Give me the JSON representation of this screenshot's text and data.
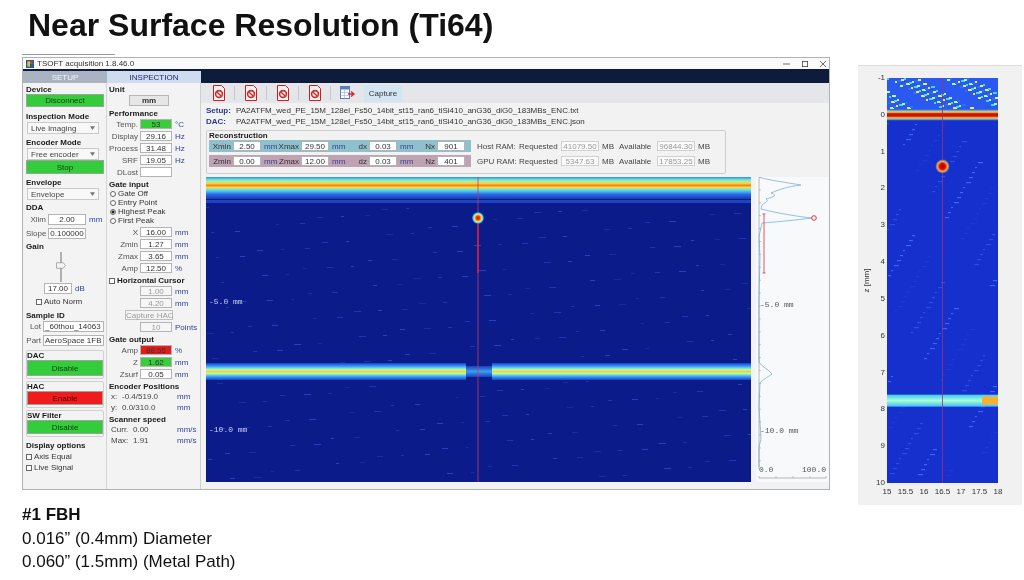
{
  "slide": {
    "title": "Near Surface Resolution (Ti64)"
  },
  "app": {
    "window_title": "TSOFT acquisition 1.8.46.0",
    "tabs": [
      {
        "label": "SETUP",
        "selected": false
      },
      {
        "label": "INSPECTION",
        "selected": true
      }
    ],
    "left_panel": {
      "device": {
        "heading": "Device",
        "button": {
          "label": "Disconnect",
          "color": "#33cc3a"
        }
      },
      "inspection_mode": {
        "heading": "Inspection Mode",
        "value": "Live Imaging"
      },
      "encoder_mode": {
        "heading": "Encoder Mode",
        "value": "Free encoder"
      },
      "stop_button": {
        "label": "Stop",
        "color": "#33cc3a"
      },
      "envelope": {
        "heading": "Envelope",
        "value": "Envelope"
      },
      "dda": {
        "heading": "DDA",
        "fields": [
          {
            "label": "Xlim",
            "value": "2.00",
            "unit": "mm"
          },
          {
            "label": "Slope",
            "value": "0.100000"
          }
        ]
      },
      "gain": {
        "heading": "Gain",
        "level": 0.55,
        "value": "17.00",
        "unit": "dB"
      },
      "auto_norm": {
        "label": "Auto Norm",
        "checked": false
      },
      "sample_id": {
        "heading": "Sample ID",
        "fields": [
          {
            "label": "Lot",
            "value": "_60thou_14063"
          },
          {
            "label": "Part",
            "value": "AeroSpace 1FB"
          }
        ]
      },
      "switches": [
        {
          "heading": "DAC",
          "button": "Disable",
          "color": "#33cc3a"
        },
        {
          "heading": "HAC",
          "button": "Enable",
          "color": "#ee1c1c"
        },
        {
          "heading": "SW Filter",
          "button": "Disable",
          "color": "#33cc3a"
        }
      ],
      "display_options": {
        "heading": "Display options",
        "checkboxes": [
          {
            "label": "Axis Equal",
            "checked": false
          },
          {
            "label": "Live Signal",
            "checked": false
          }
        ]
      }
    },
    "middle_panel": {
      "unit": {
        "heading": "Unit",
        "button": "mm"
      },
      "performance": {
        "heading": "Performance",
        "fields": [
          {
            "label": "Temp.",
            "value": "53",
            "unit": "°C",
            "color": "#3acc3a"
          },
          {
            "label": "Display",
            "value": "29.16",
            "unit": "Hz"
          },
          {
            "label": "Process",
            "value": "31.48",
            "unit": "Hz"
          },
          {
            "label": "SRF",
            "value": "19.05",
            "unit": "Hz"
          },
          {
            "label": "DLost"
          }
        ]
      },
      "gate_input": {
        "heading": "Gate input",
        "options": [
          {
            "label": "Gate Off",
            "selected": false
          },
          {
            "label": "Entry Point",
            "selected": false
          },
          {
            "label": "Highest Peak",
            "selected": true
          },
          {
            "label": "First Peak",
            "selected": false
          }
        ],
        "fields": [
          {
            "label": "X",
            "value": "16.00",
            "unit": "mm"
          },
          {
            "label": "Zmin",
            "value": "1.27",
            "unit": "mm"
          },
          {
            "label": "Zmax",
            "value": "3.65",
            "unit": "mm"
          },
          {
            "label": "Amp",
            "value": "12.50",
            "unit": "%"
          }
        ]
      },
      "horizontal_cursor": {
        "label": "Horizontal Cursor",
        "checked": false,
        "disabled": true,
        "fields": [
          {
            "value": "1.00",
            "unit": "mm"
          },
          {
            "value": "4.20",
            "unit": "mm"
          }
        ],
        "button": "Capture HAC",
        "points": {
          "value": "10",
          "unit": "Points"
        }
      },
      "gate_output": {
        "heading": "Gate output",
        "fields": [
          {
            "label": "Amp",
            "value": "88.55",
            "unit": "%",
            "color": "#e51b1b"
          },
          {
            "label": "Z",
            "value": "1.62",
            "unit": "mm",
            "color": "#3acc3a"
          },
          {
            "label": "Zsurf",
            "value": "0.05",
            "unit": "mm"
          }
        ]
      },
      "encoder_positions": {
        "heading": "Encoder Positions",
        "rows": [
          {
            "label": "x:",
            "value": "-0.4/519.0",
            "unit": "mm"
          },
          {
            "label": "y:",
            "value": "0.0/310.0",
            "unit": "mm"
          }
        ]
      },
      "scanner_speed": {
        "heading": "Scanner speed",
        "rows": [
          {
            "label": "Curr.",
            "value": "0.00",
            "unit": "mm/s"
          },
          {
            "label": "Max:",
            "value": "1.91",
            "unit": "mm/s"
          }
        ]
      }
    },
    "main": {
      "capture_button": "Capture",
      "files": [
        {
          "label": "Setup:",
          "value": "PA2ATFM_wed_PE_15M_128el_Fs50_14bit_st15_ran6_tiSi410_anG36_diG0_183MBs_ENC.txt"
        },
        {
          "label": "DAC:",
          "value": "PA2ATFM_wed_PE_15M_128el_Fs50_14bit_st15_ran6_tiSi410_anG36_diG0_183MBs_ENC.json"
        }
      ],
      "reconstruction": {
        "heading": "Reconstruction",
        "rows": [
          {
            "color": "#8fc0cb",
            "params": [
              {
                "label": "Xmin",
                "value": "2.50",
                "unit": "mm"
              },
              {
                "label": "Xmax",
                "value": "29.50",
                "unit": "mm"
              },
              {
                "label": "dx",
                "value": "0.03",
                "unit": "mm"
              },
              {
                "label": "Nx",
                "value": "901"
              }
            ],
            "ram": {
              "label": "Host RAM:",
              "requested_label": "Requested",
              "requested": "41079.50",
              "requested_unit": "MB",
              "available_label": "Available",
              "available": "96844.30",
              "available_unit": "MB"
            }
          },
          {
            "color": "#bfa3b2",
            "params": [
              {
                "label": "Zmin",
                "value": "0.00",
                "unit": "mm"
              },
              {
                "label": "Zmax",
                "value": "12.00",
                "unit": "mm"
              },
              {
                "label": "dz",
                "value": "0.03",
                "unit": "mm"
              },
              {
                "label": "Nz",
                "value": "401"
              }
            ],
            "ram": {
              "label": "GPU RAM:",
              "requested_label": "Requested",
              "requested": "5347.63",
              "requested_unit": "MB",
              "available_label": "Available",
              "available": "17853.25",
              "available_unit": "MB"
            }
          }
        ]
      },
      "bscan": {
        "depth_labels": [
          "-5.0 mm",
          "-10.0 mm"
        ]
      },
      "profile": {
        "depth_labels": [
          "-5.0 mm",
          "-10.0 mm"
        ],
        "amplitude_labels": [
          "0.0",
          "100.0"
        ]
      }
    }
  },
  "zscan_figure": {
    "ylabel": "z [mm]",
    "yticks": [
      "-1",
      "0",
      "1",
      "2",
      "3",
      "4",
      "5",
      "6",
      "7",
      "8",
      "9",
      "10"
    ],
    "xticks": [
      "15",
      "15.5",
      "16",
      "16.5",
      "17",
      "17.5",
      "18"
    ]
  },
  "caption": {
    "heading": "#1 FBH",
    "lines": [
      "0.016” (0.4mm) Diameter",
      "0.060” (1.5mm) (Metal Path)"
    ]
  }
}
